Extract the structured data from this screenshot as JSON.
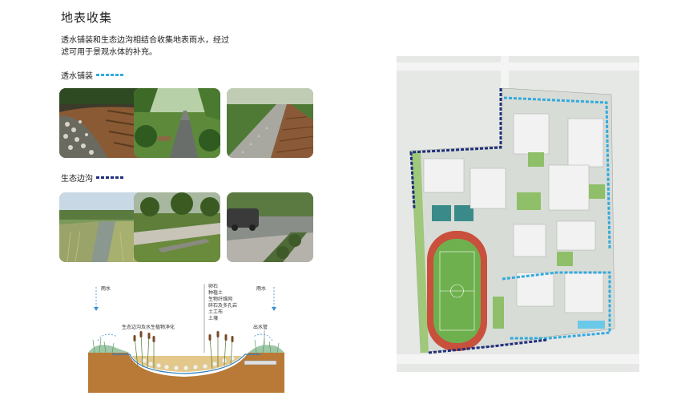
{
  "title": "地表收集",
  "intro": {
    "line1": "透水铺装和生态边沟相结合收集地表雨水，经过",
    "line2": "滤可用于景观水体的补充。"
  },
  "sections": [
    {
      "label": "透水铺装",
      "legend": "dashed-light-blue"
    },
    {
      "label": "生态边沟",
      "legend": "dashed-dark-blue"
    }
  ],
  "diagram": {
    "rain_left": "雨水",
    "rain_right": "雨水",
    "ditch_label": "生态边沟及水生植物净化",
    "outlet_label": "出水管",
    "layers": [
      "卵石",
      "种植土",
      "生物纤维网",
      "碎石及多孔岩",
      "土工布",
      "土壤"
    ]
  },
  "colors": {
    "permeable_paving": "#33aadd",
    "eco_ditch": "#1f2f7a",
    "track": "#c8503c",
    "field": "#6fb04e"
  }
}
